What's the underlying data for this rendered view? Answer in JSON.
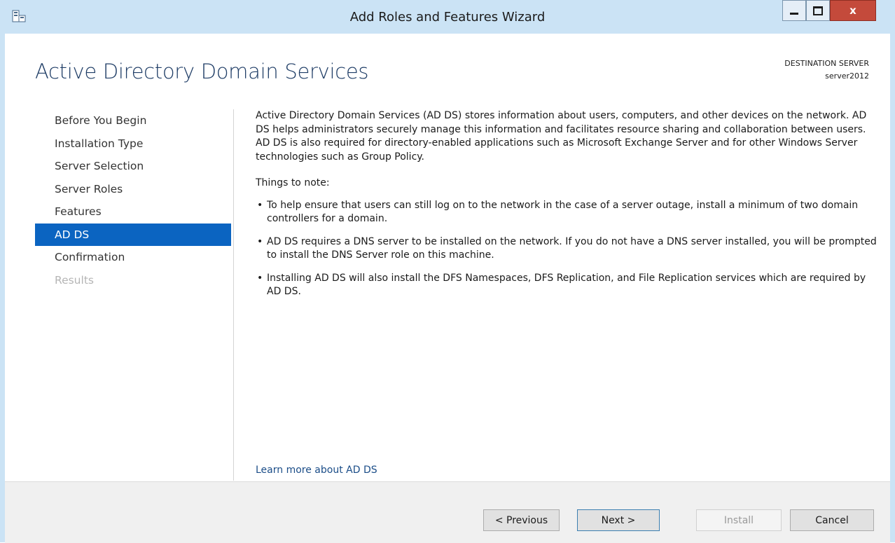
{
  "window": {
    "title": "Add Roles and Features Wizard",
    "close_glyph": "x"
  },
  "header": {
    "page_title": "Active Directory Domain Services",
    "destination_label": "DESTINATION SERVER",
    "destination_server": "server2012"
  },
  "nav": {
    "items": [
      {
        "label": "Before You Begin",
        "state": "normal"
      },
      {
        "label": "Installation Type",
        "state": "normal"
      },
      {
        "label": "Server Selection",
        "state": "normal"
      },
      {
        "label": "Server Roles",
        "state": "normal"
      },
      {
        "label": "Features",
        "state": "normal"
      },
      {
        "label": "AD DS",
        "state": "active"
      },
      {
        "label": "Confirmation",
        "state": "normal"
      },
      {
        "label": "Results",
        "state": "disabled"
      }
    ]
  },
  "main": {
    "description": "Active Directory Domain Services (AD DS) stores information about users, computers, and other devices on the network.  AD DS helps administrators securely manage this information and facilitates resource sharing and collaboration between users.  AD DS is also required for directory-enabled applications such as Microsoft Exchange Server and for other Windows Server technologies such as Group Policy.",
    "note_heading": "Things to note:",
    "bullets": [
      "To help ensure that users can still log on to the network in the case of a server outage, install a minimum of two domain controllers for a domain.",
      "AD DS requires a DNS server to be installed on the network.  If you do not have a DNS server installed, you will be prompted to install the DNS Server role on this machine.",
      "Installing AD DS will also install the DFS Namespaces, DFS Replication, and File Replication services which are required by AD DS."
    ],
    "bullet_glyph": "•",
    "learn_more": "Learn more about AD DS"
  },
  "footer": {
    "previous": "< Previous",
    "next": "Next >",
    "install": "Install",
    "cancel": "Cancel"
  },
  "colors": {
    "titlebar": "#cbe3f5",
    "accent": "#0b64c1",
    "close_button": "#c44a3b",
    "page_title": "#1f3d66",
    "link": "#1b4d88"
  },
  "icons": {
    "app": "server-manager-icon",
    "minimize": "minimize-icon",
    "maximize": "maximize-icon",
    "close": "close-icon"
  }
}
